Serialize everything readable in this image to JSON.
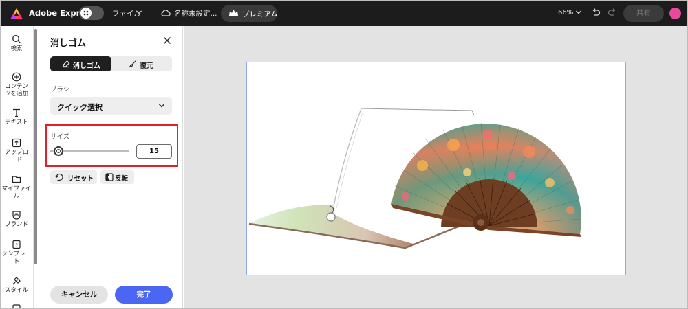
{
  "topbar": {
    "brand": "Adobe Express",
    "file_menu": "ファイル",
    "document_name": "名称未設定...",
    "premium": "プレミアム",
    "zoom": "66%",
    "share": "共有"
  },
  "rail": {
    "items": [
      {
        "label": "検索",
        "icon": "search-icon"
      },
      {
        "label": "コンテン\nツを追加",
        "icon": "plus-circle-icon"
      },
      {
        "label": "テキスト",
        "icon": "text-icon"
      },
      {
        "label": "アップロ\nード",
        "icon": "upload-icon"
      },
      {
        "label": "マイファイ\nル",
        "icon": "folder-icon"
      },
      {
        "label": "ブランド",
        "icon": "brand-icon"
      },
      {
        "label": "テンプレー\nト",
        "icon": "template-icon"
      },
      {
        "label": "スタイル",
        "icon": "style-icon"
      }
    ]
  },
  "panel": {
    "title": "消しゴム",
    "modes": {
      "erase": "消しゴム",
      "restore": "復元",
      "active": "erase"
    },
    "brush_label": "ブラシ",
    "brush_value": "クイック選択",
    "size_label": "サイズ",
    "size_value": "15",
    "size_fraction": 0.1,
    "reset": "リセット",
    "invert": "反転",
    "cancel": "キャンセル",
    "done": "完了"
  },
  "colors": {
    "topbar": "#1c1c1c",
    "accent": "#4a66f2",
    "highlight": "#e0202a",
    "artboard_border": "#8fa7ef"
  }
}
